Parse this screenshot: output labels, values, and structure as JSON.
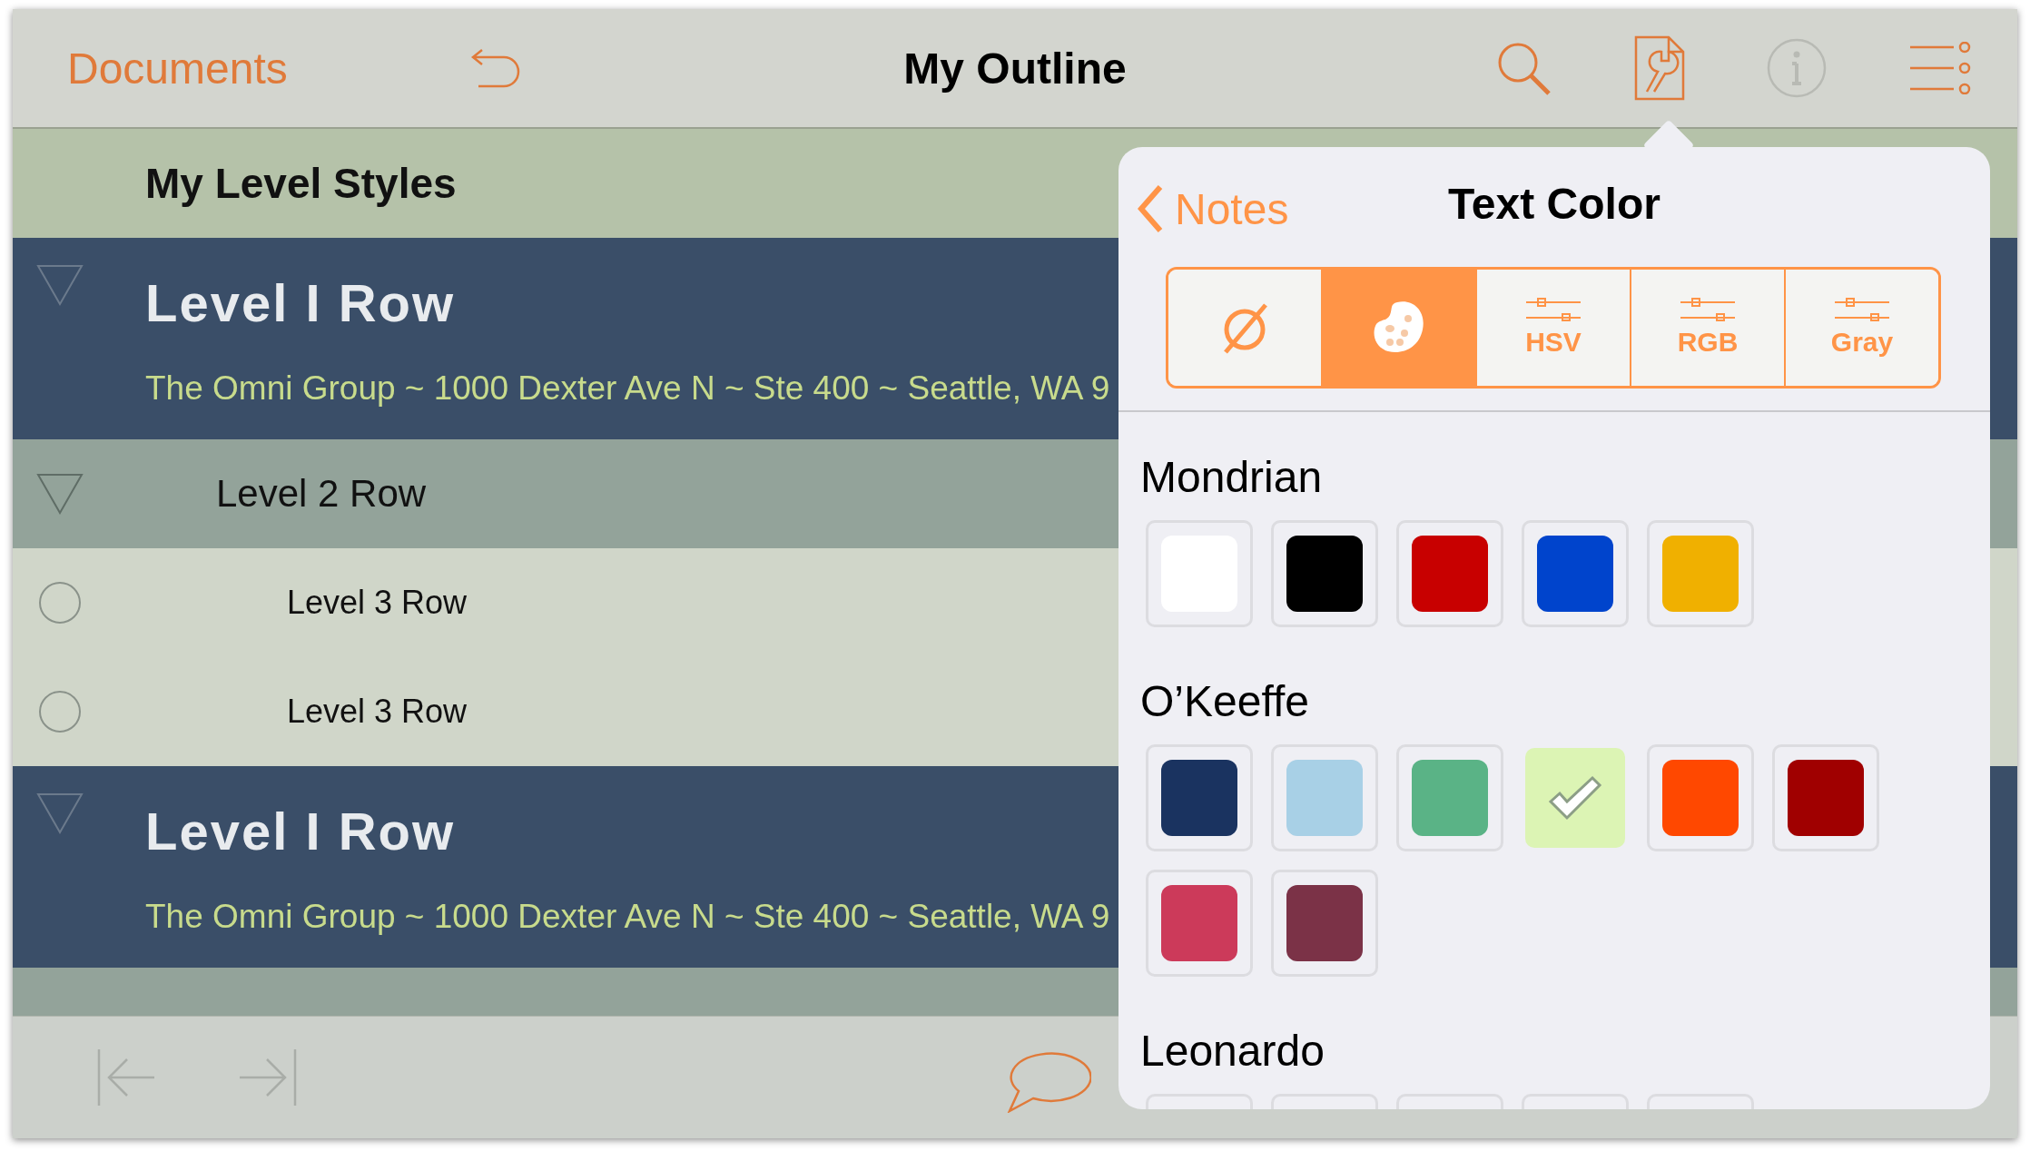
{
  "toolbar": {
    "back_label": "Documents",
    "title": "My Outline",
    "tools": [
      {
        "kind": "search",
        "disabled": false
      },
      {
        "kind": "inspector",
        "disabled": false
      },
      {
        "kind": "info",
        "disabled": true
      },
      {
        "kind": "menu",
        "disabled": false
      }
    ]
  },
  "section_title": "My Level Styles",
  "outline": [
    {
      "title": "Level I Row",
      "note": "The Omni Group ~ 1000 Dexter Ave N ~ Ste 400 ~ Seattle, WA 9",
      "expanded": true,
      "children": [
        {
          "title": "Level 2 Row",
          "expanded": true,
          "children": [
            {
              "title": "Level 3 Row"
            },
            {
              "title": "Level 3 Row"
            }
          ]
        }
      ]
    },
    {
      "title": "Level I Row",
      "note": "The Omni Group ~ 1000 Dexter Ave N ~ Ste 400 ~ Seattle, WA 9",
      "expanded": true
    }
  ],
  "popover": {
    "back_label": "Notes",
    "title": "Text Color",
    "modes": [
      {
        "kind": "none",
        "selected": false
      },
      {
        "kind": "palette",
        "selected": true
      },
      {
        "kind": "sliders",
        "label": "HSV",
        "selected": false
      },
      {
        "kind": "sliders",
        "label": "RGB",
        "selected": false
      },
      {
        "kind": "sliders",
        "label": "Gray",
        "selected": false
      }
    ],
    "palettes": [
      {
        "name": "Mondrian",
        "swatches": [
          {
            "color": "#ffffff",
            "selected": false
          },
          {
            "color": "#000000",
            "selected": false
          },
          {
            "color": "#c80000",
            "selected": false
          },
          {
            "color": "#0044cc",
            "selected": false
          },
          {
            "color": "#f0b000",
            "selected": false
          }
        ]
      },
      {
        "name": "O’Keeffe",
        "swatches": [
          {
            "color": "#1a3360",
            "selected": false
          },
          {
            "color": "#a8d0e6",
            "selected": false
          },
          {
            "color": "#5ab386",
            "selected": false
          },
          {
            "color": "#dcf4b4",
            "selected": true
          },
          {
            "color": "#ff4800",
            "selected": false
          },
          {
            "color": "#a00000",
            "selected": false
          },
          {
            "color": "#cc3a5a",
            "selected": false
          },
          {
            "color": "#7b3247",
            "selected": false
          }
        ]
      },
      {
        "name": "Leonardo",
        "swatches": [
          {
            "kind": "hidden"
          },
          {
            "kind": "hidden"
          },
          {
            "kind": "hidden"
          },
          {
            "kind": "hidden"
          },
          {
            "kind": "hidden"
          }
        ]
      }
    ]
  },
  "bottom_tools": [
    {
      "kind": "first",
      "disabled": true
    },
    {
      "kind": "last",
      "disabled": true
    },
    {
      "kind": "comment",
      "disabled": false
    }
  ]
}
